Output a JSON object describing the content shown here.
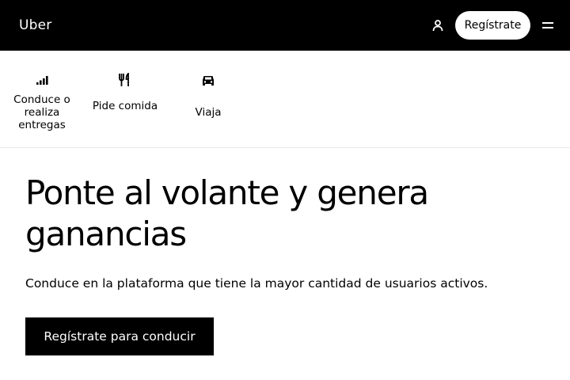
{
  "header": {
    "logo_text": "Uber",
    "user_icon": "user-icon",
    "signup_label": "Regístrate",
    "menu_icon": "hamburger-menu-icon"
  },
  "categories": [
    {
      "label": "Conduce o realiza entregas",
      "icon": "signal-bars-icon"
    },
    {
      "label": "Pide comida",
      "icon": "fork-knife-icon"
    },
    {
      "label": "Viaja",
      "icon": "car-icon"
    }
  ],
  "hero": {
    "title": "Ponte al volante y genera ganancias",
    "subtitle": "Conduce en la plataforma que tiene la mayor cantidad de usuarios activos.",
    "cta_label": "Regístrate para conducir"
  },
  "colors": {
    "header_bg": "#000000",
    "text": "#000000",
    "button_bg": "#000000",
    "button_text": "#ffffff"
  }
}
